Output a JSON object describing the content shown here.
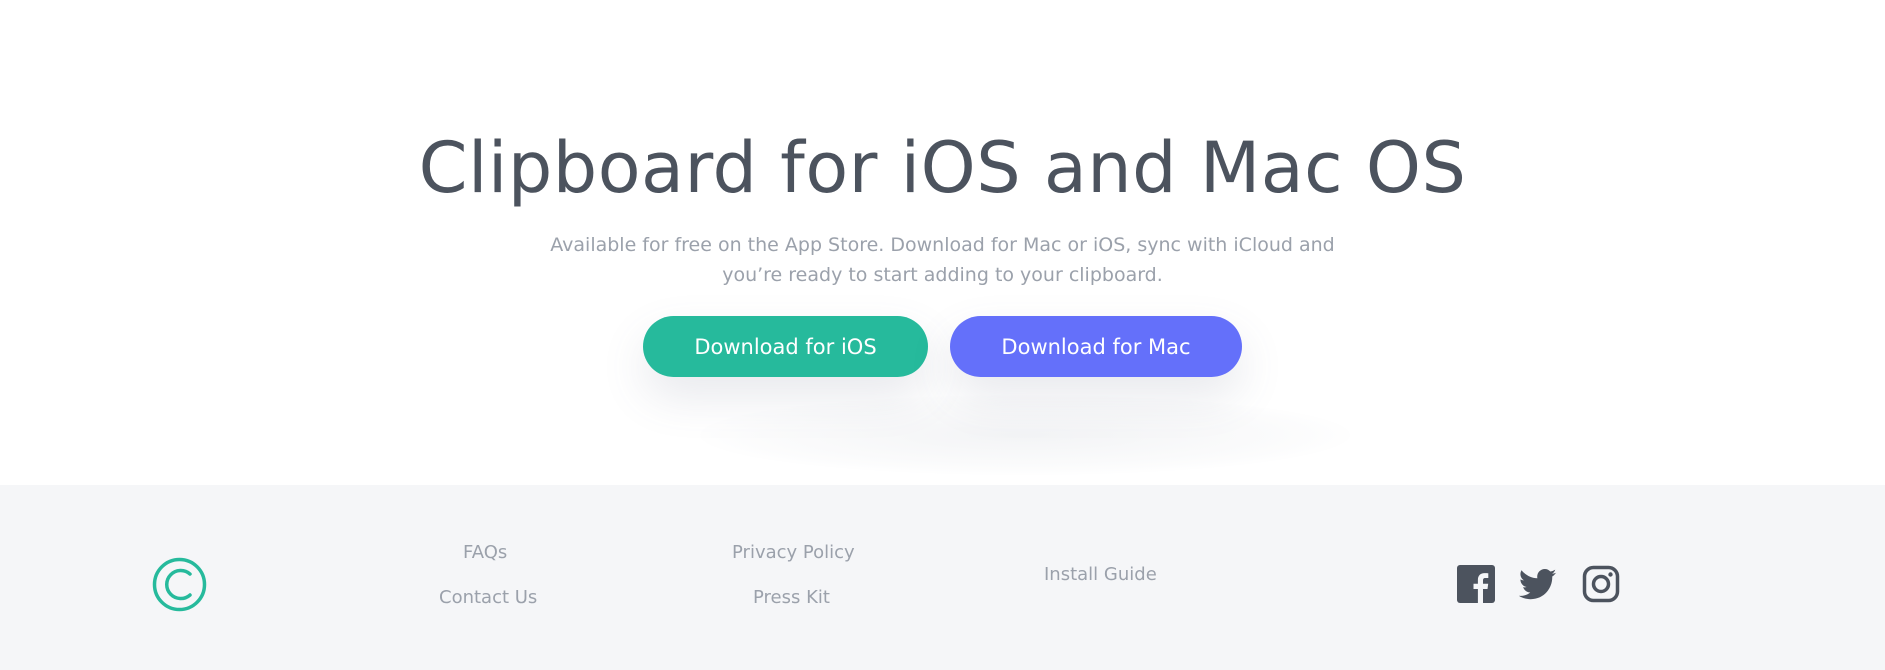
{
  "hero": {
    "title": "Clipboard for iOS and Mac OS",
    "subtitle": "Available for free on the App Store. Download for Mac or iOS, sync with iCloud and you’re ready to start adding to your clipboard.",
    "buttons": {
      "ios": "Download for iOS",
      "mac": "Download for Mac"
    }
  },
  "footer": {
    "logo": "clipboard-logo-icon",
    "links": {
      "faqs": "FAQs",
      "contact": "Contact Us",
      "privacy": "Privacy Policy",
      "press": "Press Kit",
      "install": "Install Guide"
    },
    "social": [
      "facebook-icon",
      "twitter-icon",
      "instagram-icon"
    ]
  },
  "colors": {
    "accent_green": "#26ba9c",
    "accent_blue": "#6470fa",
    "heading": "#4c535e",
    "muted": "#9ba1ab",
    "footer_bg": "#f5f6f8",
    "icon_dark": "#4c535e"
  }
}
